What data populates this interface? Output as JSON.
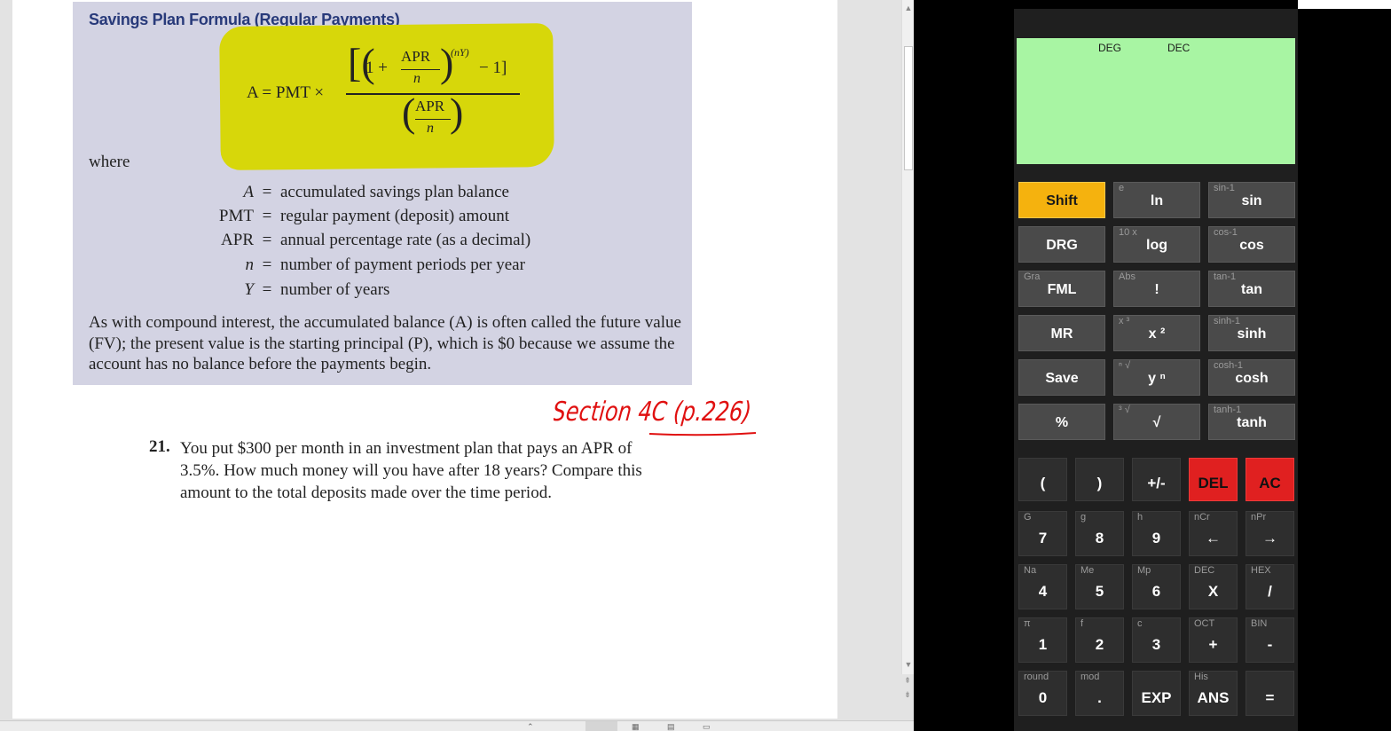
{
  "document": {
    "box_title": "Savings Plan Formula (Regular Payments)",
    "formula": {
      "lhs": "A = PMT ×",
      "open_bracket": "[(",
      "one_plus": "1 +",
      "apr": "APR",
      "n": "n",
      "close_paren": ")",
      "exponent": "(nY)",
      "minus_one": "− 1]",
      "den_open": "(",
      "den_apr": "APR",
      "den_n": "n",
      "den_close": ")"
    },
    "where": "where",
    "definitions": [
      {
        "var": "A",
        "eq": "=",
        "text": "accumulated savings plan balance"
      },
      {
        "var": "PMT",
        "eq": "=",
        "text": "regular payment (deposit) amount"
      },
      {
        "var": "APR",
        "eq": "=",
        "text": "annual percentage rate (as a decimal)"
      },
      {
        "var": "n",
        "eq": "=",
        "text": "number of payment periods per year"
      },
      {
        "var": "Y",
        "eq": "=",
        "text": "number of years"
      }
    ],
    "paragraph": "As with compound interest, the accumulated balance (A) is often called the future value (FV); the present value is the starting principal (P), which is $0 because we assume the account has no balance before the payments begin.",
    "handwritten_note": "Section 4C (p.226)",
    "question_number": "21.",
    "question_text": "You put $300 per month in an investment plan that pays an APR of 3.5%. How much money will you have after 18 years? Compare this amount to the total deposits made over the time period."
  },
  "calculator": {
    "display": {
      "angle_mode": "DEG",
      "number_mode": "DEC",
      "value": ""
    },
    "colors": {
      "display": "#a8f5a3",
      "shift": "#f5b20e",
      "danger": "#e02020",
      "key": "#4a4a4a"
    },
    "sci_keys": [
      {
        "label": "Shift",
        "sub": ""
      },
      {
        "label": "ln",
        "sub": "e"
      },
      {
        "label": "sin",
        "sub": "sin-1"
      },
      {
        "label": "DRG",
        "sub": ""
      },
      {
        "label": "log",
        "sub": "10 x"
      },
      {
        "label": "cos",
        "sub": "cos-1"
      },
      {
        "label": "FML",
        "sub": "Gra"
      },
      {
        "label": "!",
        "sub": "Abs"
      },
      {
        "label": "tan",
        "sub": "tan-1"
      },
      {
        "label": "MR",
        "sub": ""
      },
      {
        "label": "x ²",
        "sub": "x ³"
      },
      {
        "label": "sinh",
        "sub": "sinh-1"
      },
      {
        "label": "Save",
        "sub": ""
      },
      {
        "label": "y ⁿ",
        "sub": "ⁿ √"
      },
      {
        "label": "cosh",
        "sub": "cosh-1"
      },
      {
        "label": "%",
        "sub": ""
      },
      {
        "label": "√",
        "sub": "³ √"
      },
      {
        "label": "tanh",
        "sub": "tanh-1"
      }
    ],
    "num_keys": [
      {
        "label": "(",
        "sub": ""
      },
      {
        "label": ")",
        "sub": ""
      },
      {
        "label": "+/-",
        "sub": ""
      },
      {
        "label": "DEL",
        "sub": ""
      },
      {
        "label": "AC",
        "sub": ""
      },
      {
        "label": "7",
        "sub": "G"
      },
      {
        "label": "8",
        "sub": "g"
      },
      {
        "label": "9",
        "sub": "h"
      },
      {
        "label": "←",
        "sub": "nCr"
      },
      {
        "label": "→",
        "sub": "nPr"
      },
      {
        "label": "4",
        "sub": "Na"
      },
      {
        "label": "5",
        "sub": "Me"
      },
      {
        "label": "6",
        "sub": "Mp"
      },
      {
        "label": "X",
        "sub": "DEC"
      },
      {
        "label": "/",
        "sub": "HEX"
      },
      {
        "label": "1",
        "sub": "π"
      },
      {
        "label": "2",
        "sub": "f"
      },
      {
        "label": "3",
        "sub": "c"
      },
      {
        "label": "+",
        "sub": "OCT"
      },
      {
        "label": "-",
        "sub": "BIN"
      },
      {
        "label": "0",
        "sub": "round"
      },
      {
        "label": ".",
        "sub": "mod"
      },
      {
        "label": "EXP",
        "sub": ""
      },
      {
        "label": "ANS",
        "sub": "His"
      },
      {
        "label": "=",
        "sub": ""
      }
    ]
  }
}
